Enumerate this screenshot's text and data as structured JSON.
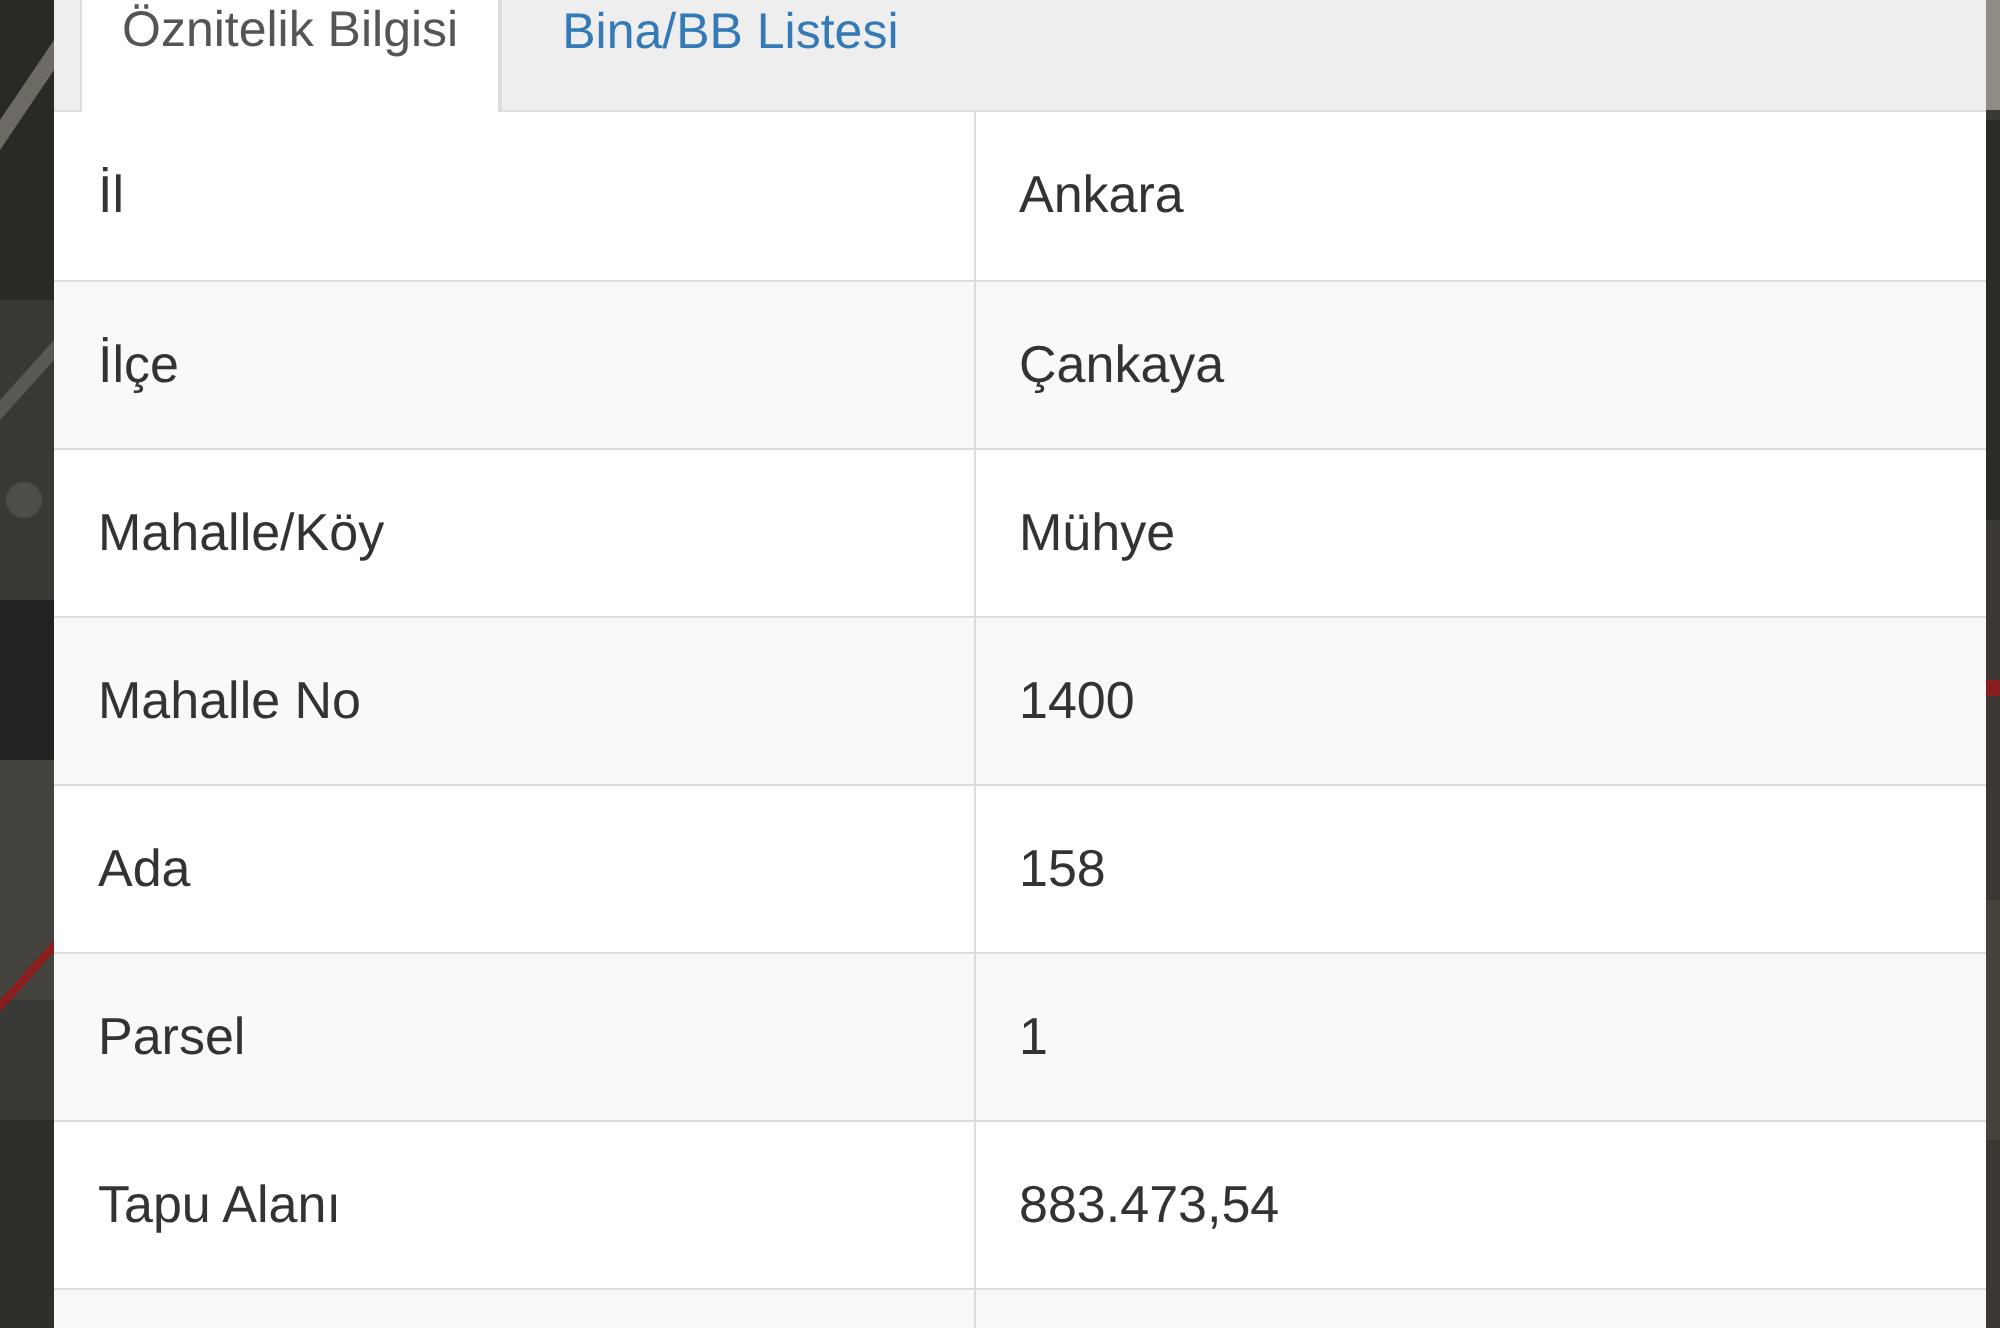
{
  "tabs": [
    {
      "label": "Öznitelik Bilgisi",
      "selected": true
    },
    {
      "label": "Bina/BB Listesi",
      "selected": false
    }
  ],
  "rows": [
    {
      "label": "İl",
      "value": "Ankara"
    },
    {
      "label": "İlçe",
      "value": "Çankaya"
    },
    {
      "label": "Mahalle/Köy",
      "value": "Mühye"
    },
    {
      "label": "Mahalle No",
      "value": "1400"
    },
    {
      "label": "Ada",
      "value": "158"
    },
    {
      "label": "Parsel",
      "value": "1"
    },
    {
      "label": "Tapu Alanı",
      "value": "883.473,54"
    }
  ]
}
